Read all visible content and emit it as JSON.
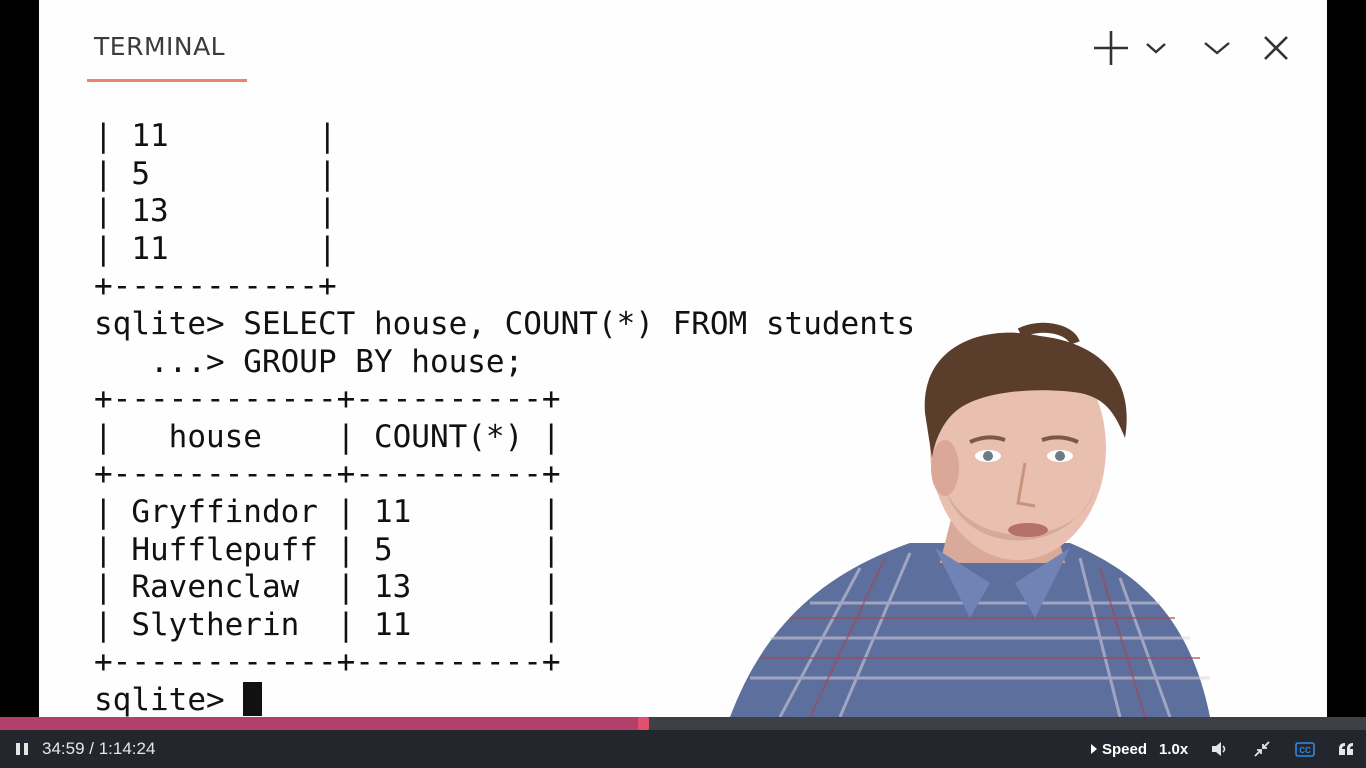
{
  "panel": {
    "tab_label": "TERMINAL",
    "actions": {
      "new": "new-terminal-icon",
      "new_menu": "chevron-down-icon",
      "collapse": "chevron-down-icon",
      "close": "close-icon"
    }
  },
  "terminal": {
    "lines": [
      "| 11        |",
      "| 5         |",
      "| 13        |",
      "| 11        |",
      "+-----------+",
      "sqlite> SELECT house, COUNT(*) FROM students",
      "   ...> GROUP BY house;",
      "+------------+----------+",
      "|   house    | COUNT(*) |",
      "+------------+----------+",
      "| Gryffindor | 11       |",
      "| Hufflepuff | 5        |",
      "| Ravenclaw  | 13       |",
      "| Slytherin  | 11       |",
      "+------------+----------+"
    ],
    "prompt": "sqlite> "
  },
  "player": {
    "current_time": "34:59",
    "total_time": "1:14:24",
    "time_display": "34:59 / 1:14:24",
    "progress_fraction": 0.4703,
    "speed_label": "Speed",
    "speed_value": "1.0x",
    "colors": {
      "progress_fill": "#b1416b",
      "control_bar": "#23272d",
      "cc_active": "#2c8be9"
    },
    "icons": {
      "play_pause": "pause-icon",
      "speed_toggle": "triangle-right-icon",
      "volume": "volume-icon",
      "fullscreen": "exit-fullscreen-icon",
      "captions": "captions-icon",
      "transcript": "quote-icon"
    }
  }
}
